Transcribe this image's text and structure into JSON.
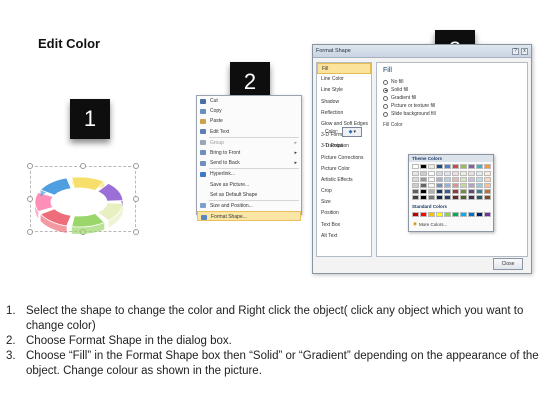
{
  "page_title": "Edit Color",
  "steps": [
    "1",
    "2",
    "3"
  ],
  "ring_colors": [
    "#e8f0c2",
    "#9bd66b",
    "#ee6d7a",
    "#ff8fb8",
    "#4f9ee0",
    "#f6df6a",
    "#9a6fd6"
  ],
  "context_menu": {
    "items": [
      {
        "label": "Cut",
        "icon": "scissors-icon",
        "disabled": false
      },
      {
        "label": "Copy",
        "icon": "copy-icon",
        "disabled": false
      },
      {
        "label": "Paste",
        "icon": "paste-icon",
        "disabled": false
      },
      {
        "label": "Edit Text",
        "icon": "edit-text-icon",
        "disabled": false
      },
      {
        "label": "Group",
        "icon": "group-icon",
        "disabled": true,
        "submenu": true
      },
      {
        "label": "Bring to Front",
        "icon": "bring-front-icon",
        "disabled": false,
        "submenu": true
      },
      {
        "label": "Send to Back",
        "icon": "send-back-icon",
        "disabled": false,
        "submenu": true
      },
      {
        "label": "Hyperlink...",
        "icon": "hyperlink-icon",
        "disabled": false
      },
      {
        "label": "Save as Picture...",
        "icon": "",
        "disabled": false
      },
      {
        "label": "Set as Default Shape",
        "icon": "",
        "disabled": false
      },
      {
        "label": "Size and Position...",
        "icon": "size-icon",
        "disabled": false
      },
      {
        "label": "Format Shape...",
        "icon": "format-shape-icon",
        "disabled": false,
        "active": true
      }
    ]
  },
  "dialog": {
    "title": "Format Shape",
    "help_btn": "?",
    "close_x": "x",
    "nav_items": [
      "Fill",
      "Line Color",
      "Line Style",
      "Shadow",
      "Reflection",
      "Glow and Soft Edges",
      "3-D Format",
      "3-D Rotation",
      "Picture Corrections",
      "Picture Color",
      "Artistic Effects",
      "Crop",
      "Size",
      "Position",
      "Text Box",
      "Alt Text"
    ],
    "selected_nav": "Fill",
    "pane_title": "Fill",
    "fill_options": [
      {
        "label": "No fill",
        "checked": false
      },
      {
        "label": "Solid fill",
        "checked": true
      },
      {
        "label": "Gradient fill",
        "checked": false
      },
      {
        "label": "Picture or texture fill",
        "checked": false
      },
      {
        "label": "Slide background fill",
        "checked": false
      }
    ],
    "fill_color_label": "Fill Color",
    "color_label": "Color:",
    "transparency_label": "Transpa",
    "close_button": "Close"
  },
  "color_picker": {
    "theme_heading": "Theme Colors",
    "standard_heading": "Standard Colors",
    "more_colors": "More Colors...",
    "theme_columns": [
      "#ffffff",
      "#000000",
      "#eeece1",
      "#1f497d",
      "#4f81bd",
      "#c0504d",
      "#9bbb59",
      "#8064a2",
      "#4bacc6",
      "#f79646"
    ],
    "standard_colors": [
      "#c00000",
      "#ff0000",
      "#ffc000",
      "#ffff00",
      "#92d050",
      "#00b050",
      "#00b0f0",
      "#0070c0",
      "#002060",
      "#7030a0"
    ]
  },
  "instructions": [
    {
      "num": "1.",
      "text": "Select the shape to change the color and Right click the object( click any object which you want to change color)"
    },
    {
      "num": "2.",
      "text": "Choose Format Shape in the dialog box."
    },
    {
      "num": "3.",
      "text": "Choose “Fill” in the Format Shape box then “Solid” or “Gradient” depending on the appearance of the object. Change colour as shown in the picture."
    }
  ]
}
